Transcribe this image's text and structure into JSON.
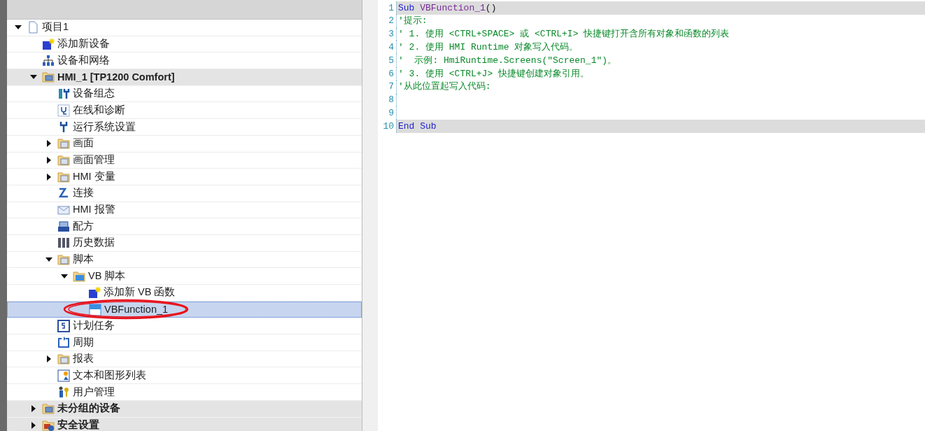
{
  "tree": [
    {
      "label": "项目1",
      "kind": "page",
      "expanded": true,
      "selected": false,
      "emphasis": false,
      "children": [
        {
          "label": "添加新设备",
          "kind": "add",
          "selected": false,
          "emphasis": false
        },
        {
          "label": "设备和网络",
          "kind": "network",
          "selected": false,
          "emphasis": false
        },
        {
          "label": "HMI_1 [TP1200 Comfort]",
          "kind": "device",
          "expanded": true,
          "selected": false,
          "emphasis": true,
          "children": [
            {
              "label": "设备组态",
              "kind": "config",
              "selected": false,
              "emphasis": false
            },
            {
              "label": "在线和诊断",
              "kind": "diagnose",
              "selected": false,
              "emphasis": false
            },
            {
              "label": "运行系统设置",
              "kind": "wrench",
              "selected": false,
              "emphasis": false
            },
            {
              "label": "画面",
              "kind": "folder",
              "expanded": false,
              "selected": false,
              "emphasis": false
            },
            {
              "label": "画面管理",
              "kind": "folder",
              "expanded": false,
              "selected": false,
              "emphasis": false
            },
            {
              "label": "HMI 变量",
              "kind": "folder",
              "expanded": false,
              "selected": false,
              "emphasis": false
            },
            {
              "label": "连接",
              "kind": "connection",
              "selected": false,
              "emphasis": false
            },
            {
              "label": "HMI 报警",
              "kind": "mail",
              "selected": false,
              "emphasis": false
            },
            {
              "label": "配方",
              "kind": "recipe",
              "selected": false,
              "emphasis": false
            },
            {
              "label": "历史数据",
              "kind": "archive",
              "selected": false,
              "emphasis": false
            },
            {
              "label": "脚本",
              "kind": "folder",
              "expanded": true,
              "selected": false,
              "emphasis": false,
              "children": [
                {
                  "label": "VB 脚本",
                  "kind": "vbfolder",
                  "expanded": true,
                  "selected": false,
                  "emphasis": false,
                  "children": [
                    {
                      "label": "添加新 VB 函数",
                      "kind": "add",
                      "selected": false,
                      "emphasis": false
                    },
                    {
                      "label": "VBFunction_1",
                      "kind": "vb",
                      "selected": true,
                      "emphasis": false
                    }
                  ]
                }
              ]
            },
            {
              "label": "计划任务",
              "kind": "schedule",
              "selected": false,
              "emphasis": false
            },
            {
              "label": "周期",
              "kind": "cycle",
              "selected": false,
              "emphasis": false
            },
            {
              "label": "报表",
              "kind": "folder",
              "expanded": false,
              "selected": false,
              "emphasis": false
            },
            {
              "label": "文本和图形列表",
              "kind": "list",
              "selected": false,
              "emphasis": false
            },
            {
              "label": "用户管理",
              "kind": "user",
              "selected": false,
              "emphasis": false
            }
          ]
        },
        {
          "label": "未分组的设备",
          "kind": "device",
          "expanded": false,
          "selected": false,
          "emphasis": true
        },
        {
          "label": "安全设置",
          "kind": "security",
          "expanded": false,
          "selected": false,
          "emphasis": true
        }
      ]
    }
  ],
  "code": [
    {
      "number": "1",
      "highlighted": true,
      "tokens": [
        {
          "kind": "keyword",
          "text": "Sub"
        },
        {
          "kind": "name",
          "text": "VBFunction_1"
        },
        {
          "kind": "plain",
          "text": "()"
        }
      ]
    },
    {
      "number": "2",
      "highlighted": false,
      "tokens": [
        {
          "kind": "comment",
          "text": "'提示:"
        }
      ]
    },
    {
      "number": "3",
      "highlighted": false,
      "tokens": [
        {
          "kind": "comment",
          "text": "' 1. 使用 <CTRL+SPACE> 或 <CTRL+I> 快捷键打开含所有对象和函数的列表"
        }
      ]
    },
    {
      "number": "4",
      "highlighted": false,
      "tokens": [
        {
          "kind": "comment",
          "text": "' 2. 使用 HMI Runtime 对象写入代码。"
        }
      ]
    },
    {
      "number": "5",
      "highlighted": false,
      "tokens": [
        {
          "kind": "comment",
          "text": "'  示例: HmiRuntime.Screens(\"Screen_1\")。"
        }
      ]
    },
    {
      "number": "6",
      "highlighted": false,
      "tokens": [
        {
          "kind": "comment",
          "text": "' 3. 使用 <CTRL+J> 快捷键创建对象引用。"
        }
      ]
    },
    {
      "number": "7",
      "highlighted": false,
      "tokens": [
        {
          "kind": "comment",
          "text": "'从此位置起写入代码:"
        }
      ]
    },
    {
      "number": "8",
      "highlighted": false
    },
    {
      "number": "9",
      "highlighted": false
    },
    {
      "number": "10",
      "highlighted": true,
      "tokens": [
        {
          "kind": "keyword",
          "text": "End"
        },
        {
          "kind": "keyword",
          "text": "Sub"
        }
      ]
    }
  ]
}
